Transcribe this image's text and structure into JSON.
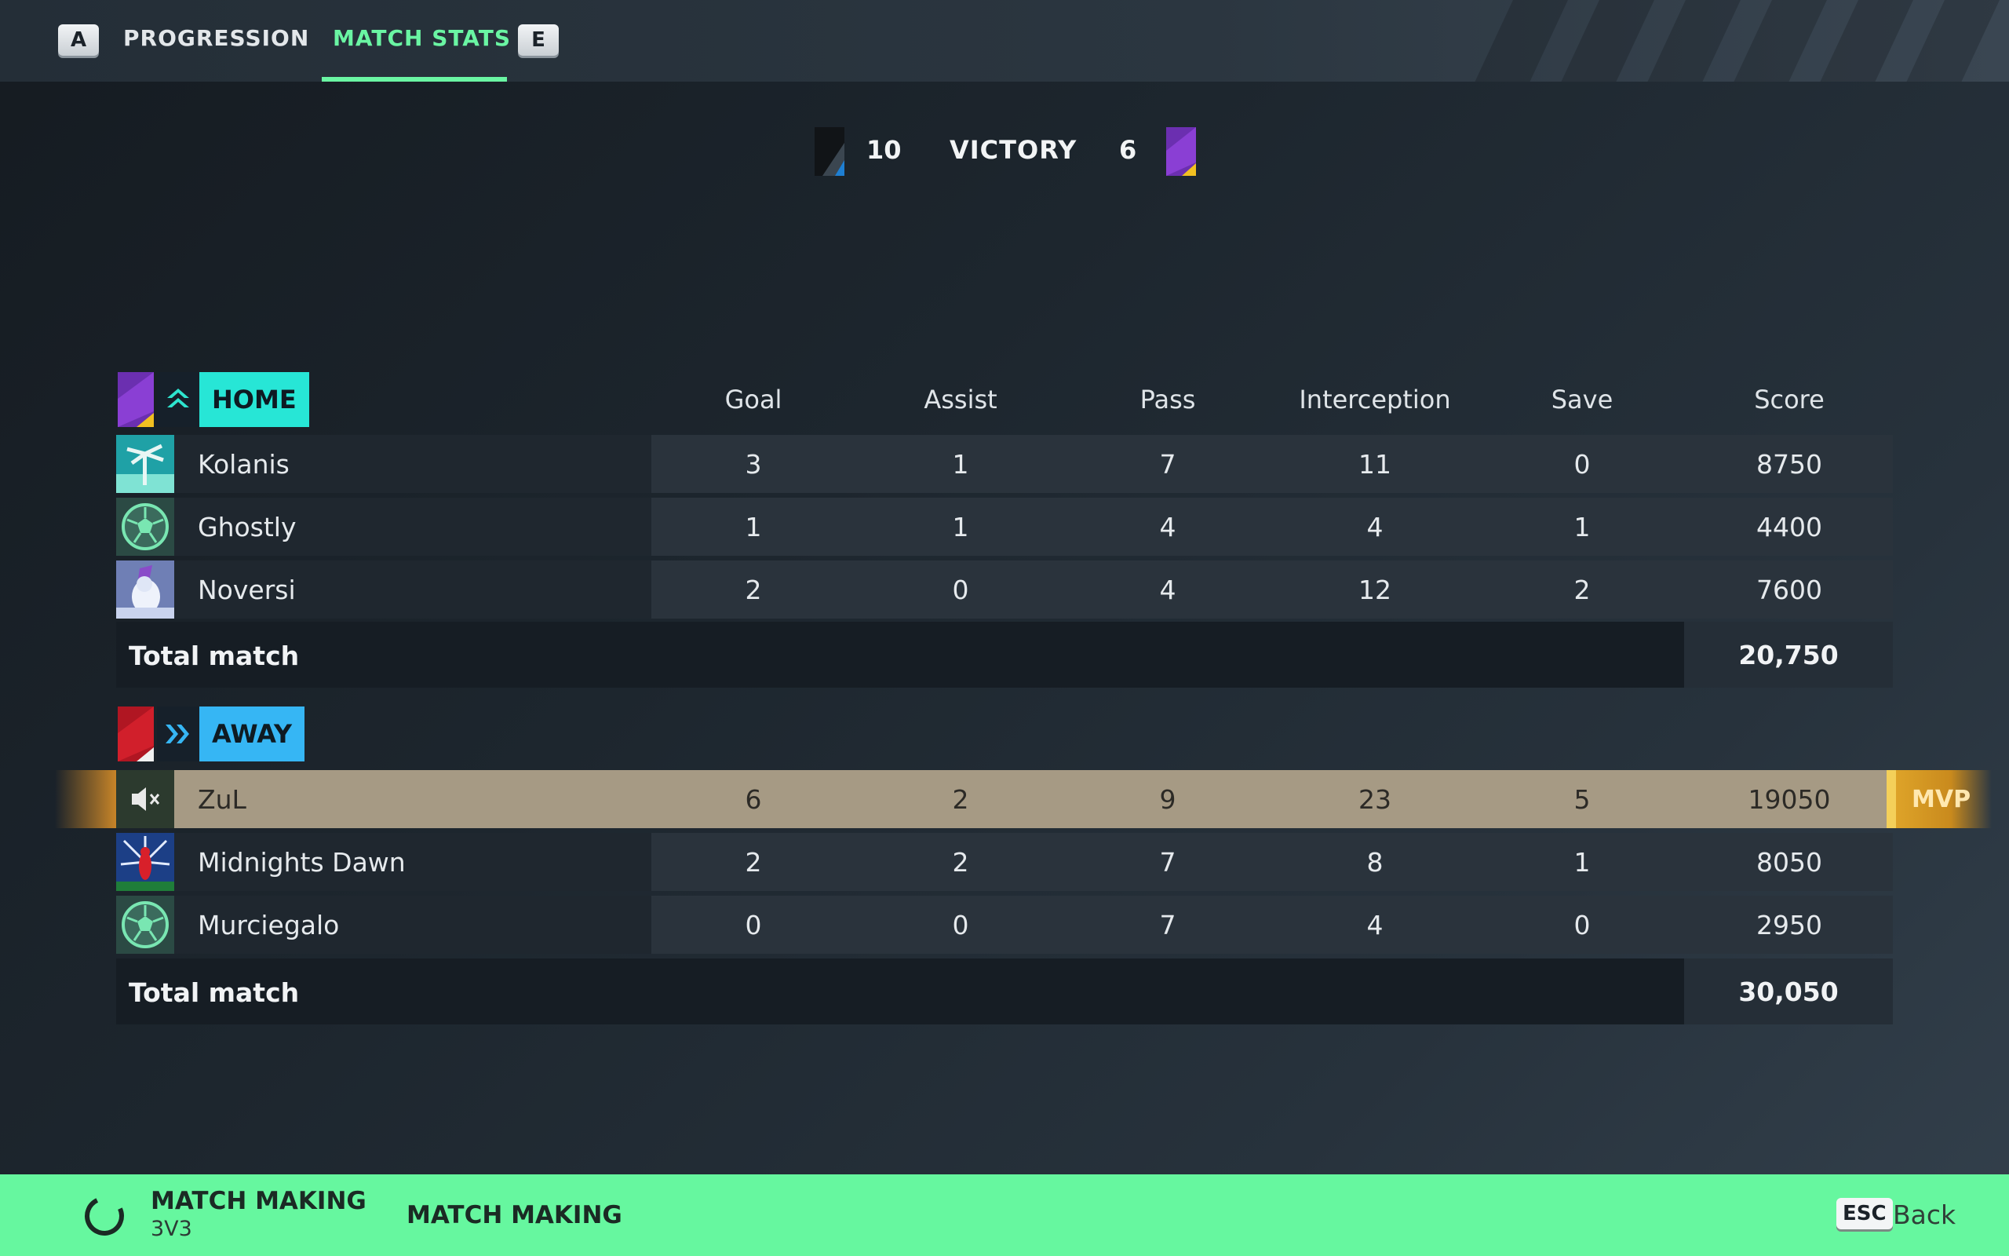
{
  "tabs": {
    "left_key": "A",
    "right_key": "E",
    "progression": "PROGRESSION",
    "match_stats": "MATCH STATS"
  },
  "result": {
    "home_score": "10",
    "label": "VICTORY",
    "away_score": "6"
  },
  "columns": [
    "Goal",
    "Assist",
    "Pass",
    "Interception",
    "Save",
    "Score"
  ],
  "home": {
    "name": "HOME",
    "accent": "#27e6d6",
    "players": [
      {
        "name": "Kolanis",
        "stats": [
          "3",
          "1",
          "7",
          "11",
          "0",
          "8750"
        ]
      },
      {
        "name": "Ghostly",
        "stats": [
          "1",
          "1",
          "4",
          "4",
          "1",
          "4400"
        ]
      },
      {
        "name": "Noversi",
        "stats": [
          "2",
          "0",
          "4",
          "12",
          "2",
          "7600"
        ]
      }
    ],
    "total_label": "Total match",
    "total_score": "20,750"
  },
  "away": {
    "name": "AWAY",
    "accent": "#36b6f4",
    "players": [
      {
        "name": "ZuL",
        "stats": [
          "6",
          "2",
          "9",
          "23",
          "5",
          "19050"
        ],
        "mvp": true
      },
      {
        "name": "Midnights Dawn",
        "stats": [
          "2",
          "2",
          "7",
          "8",
          "1",
          "8050"
        ]
      },
      {
        "name": "Murciegalo",
        "stats": [
          "0",
          "0",
          "7",
          "4",
          "0",
          "2950"
        ]
      }
    ],
    "total_label": "Total match",
    "total_score": "30,050"
  },
  "mvp_label": "MVP",
  "footer": {
    "status_title": "MATCH MAKING",
    "status_mode": "3V3",
    "action": "MATCH MAKING",
    "esc_key": "ESC",
    "back_label": "Back"
  },
  "colors": {
    "accent_green": "#6af5a3",
    "footer_green": "#66f79f",
    "mvp_gold": "#e0a62a"
  }
}
